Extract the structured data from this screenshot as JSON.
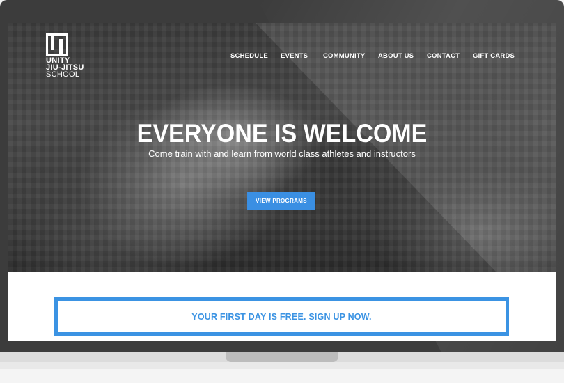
{
  "logo": {
    "line1": "UNITY",
    "line2": "JIU-JITSU",
    "line3": "SCHOOL"
  },
  "nav": {
    "items": [
      "SCHEDULE",
      "EVENTS",
      "COMMUNITY",
      "ABOUT US",
      "CONTACT",
      "GIFT CARDS"
    ]
  },
  "hero": {
    "headline": "EVERYONE IS WELCOME",
    "subline": "Come train with and learn from world class athletes and instructors",
    "cta_label": "VIEW PROGRAMS"
  },
  "promo": {
    "text": "YOUR FIRST DAY IS FREE. SIGN UP NOW."
  },
  "colors": {
    "accent": "#3a8fe3",
    "bezel": "#3c3c3c"
  }
}
